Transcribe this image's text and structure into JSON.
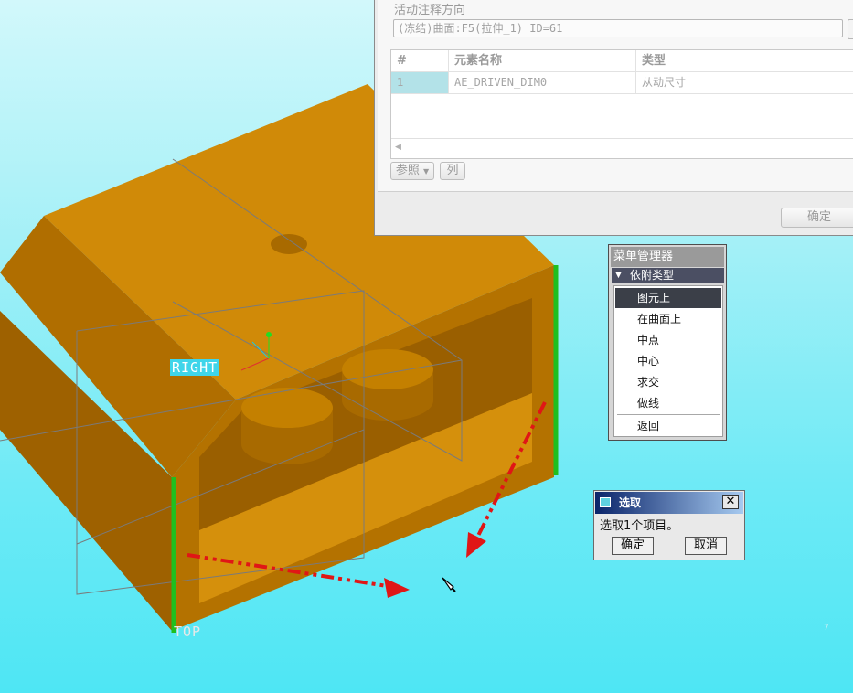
{
  "viewport": {
    "datum_right_label": "RIGHT",
    "datum_top_label": "TOP",
    "corner_mark": "7",
    "model_color": "#c78000",
    "highlight_color": "#1fbf1f",
    "arrow_color": "#e01616"
  },
  "annotation_dialog": {
    "direction_label": "活动注释方向",
    "direction_value": "(冻结)曲面:F5(拉伸_1) ID=61",
    "table": {
      "headers": [
        "#",
        "元素名称",
        "类型"
      ],
      "rows": [
        {
          "index": "1",
          "name": "AE_DRIVEN_DIM0",
          "type": "从动尺寸"
        }
      ]
    },
    "ref_button": "参照",
    "col_button": "列",
    "ok_button": "确定"
  },
  "menu_manager": {
    "title": "菜单管理器",
    "submenu": "依附类型",
    "items": [
      "图元上",
      "在曲面上",
      "中点",
      "中心",
      "求交",
      "做线",
      "返回"
    ],
    "selected_item": "图元上"
  },
  "select_dialog": {
    "title": "选取",
    "message": "选取1个项目。",
    "ok_button": "确定",
    "cancel_button": "取消",
    "close_glyph": "✕"
  }
}
